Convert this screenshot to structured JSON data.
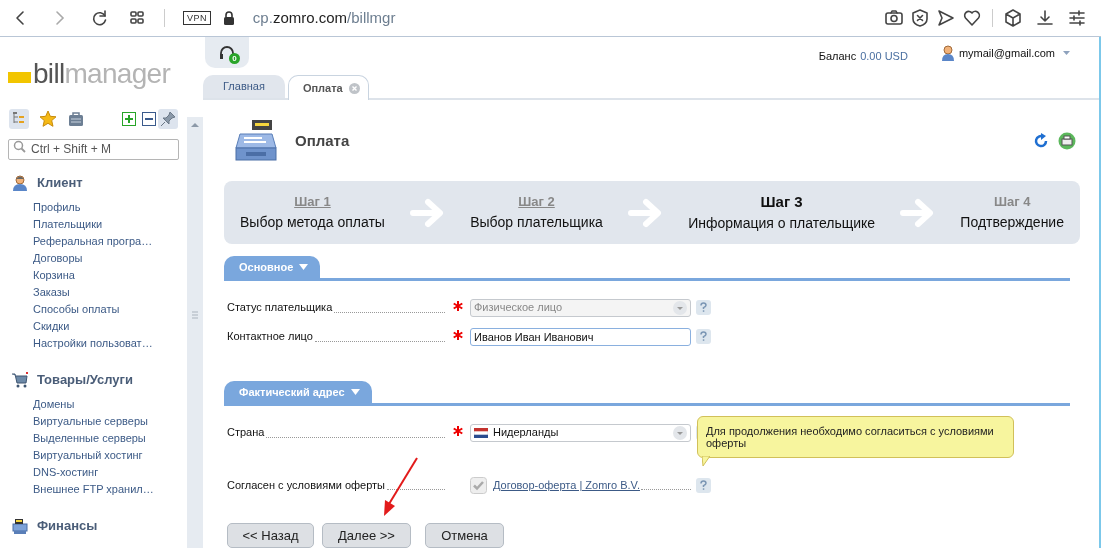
{
  "browser": {
    "url_parts": [
      "cp.",
      "zomro.com",
      "/billmgr"
    ],
    "vpn": "VPN"
  },
  "header": {
    "support_badge": "0",
    "balance_label": "Баланс",
    "balance_value": "0.00 USD",
    "user": "mymail@gmail.com"
  },
  "logo": [
    "bill",
    "manager"
  ],
  "sidebar": {
    "search": {
      "placeholder": "Ctrl + Shift + M"
    },
    "sections": [
      {
        "kind": "client",
        "title": "Клиент",
        "items": [
          "Профиль",
          "Плательщики",
          "Реферальная програ…",
          "Договоры",
          "Корзина",
          "Заказы",
          "Способы оплаты",
          "Скидки",
          "Настройки пользоват…"
        ]
      },
      {
        "kind": "cart",
        "title": "Товары/Услуги",
        "items": [
          "Домены",
          "Виртуальные серверы",
          "Выделенные серверы",
          "Виртуальный хостинг",
          "DNS-хостинг",
          "Внешнее FTP хранил…"
        ]
      },
      {
        "kind": "register",
        "title": "Финансы"
      }
    ]
  },
  "tabs": [
    {
      "label": "Главная",
      "selected": false
    },
    {
      "label": "Оплата",
      "selected": true,
      "closable": true
    }
  ],
  "page": {
    "title": "Оплата"
  },
  "steps": [
    {
      "label": "Шаг 1",
      "description": "Выбор метода оплаты",
      "selected": false,
      "completed": true
    },
    {
      "label": "Шаг 2",
      "description": "Выбор плательщика",
      "selected": false,
      "completed": true
    },
    {
      "label": "Шаг 3",
      "description": "Информация о плательщике",
      "selected": true,
      "completed": false
    },
    {
      "label": "Шаг 4",
      "description": "Подтверждение",
      "selected": false,
      "completed": false
    }
  ],
  "sections": [
    {
      "title": "Основное",
      "fields": [
        {
          "kind": "select",
          "label": "Статус плательщика",
          "required": true,
          "value": "Физическое лицо",
          "disabled": true
        },
        {
          "kind": "input",
          "label": "Контактное лицо",
          "required": true,
          "value": "Иванов Иван Иванович"
        }
      ]
    },
    {
      "title": "Фактический адрес",
      "fields": [
        {
          "kind": "select",
          "label": "Страна",
          "required": true,
          "value": "Нидерланды",
          "disabled": false,
          "flag": true
        },
        {
          "kind": "checkbox",
          "label": "Согласен с условиями оферты",
          "link": "Договор-оферта | Zomro B.V.",
          "checked": true
        }
      ]
    }
  ],
  "tooltip": "Для продолжения необходимо согласиться с условиями оферты",
  "buttons": [
    "<< Назад",
    "Далее >>",
    "Отмена"
  ]
}
